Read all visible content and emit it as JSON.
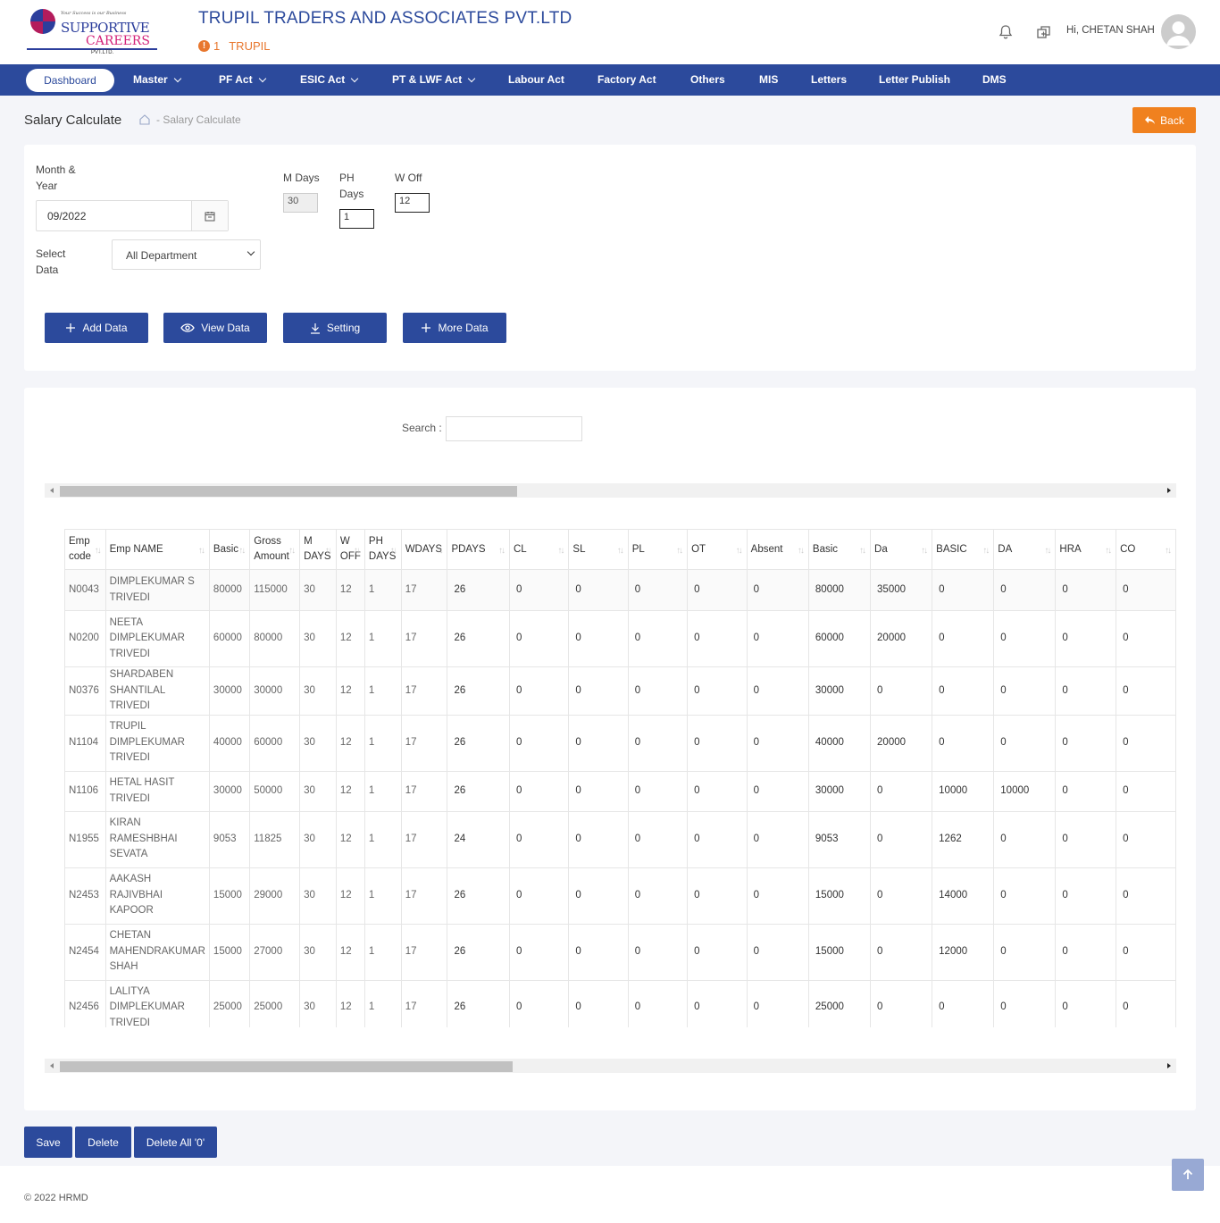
{
  "brand": {
    "tagline": "Your Success is our Business",
    "line1": "SUPPORTIVE",
    "line2": "CAREERS",
    "line3": "PVT.LTD."
  },
  "header": {
    "company_title": "TRUPIL TRADERS AND ASSOCIATES PVT.LTD",
    "sub_count": "1",
    "sub_name": "TRUPIL",
    "greeting": "Hi,  CHETAN SHAH"
  },
  "nav": {
    "items": [
      {
        "label": "Dashboard"
      },
      {
        "label": "Master"
      },
      {
        "label": "PF Act"
      },
      {
        "label": "ESIC Act"
      },
      {
        "label": "PT & LWF Act"
      },
      {
        "label": "Labour Act"
      },
      {
        "label": "Factory Act"
      },
      {
        "label": "Others"
      },
      {
        "label": "MIS"
      },
      {
        "label": "Letters"
      },
      {
        "label": "Letter Publish"
      },
      {
        "label": "DMS"
      }
    ]
  },
  "page": {
    "title": "Salary Calculate",
    "breadcrumb": "- Salary Calculate",
    "back_label": "Back"
  },
  "form": {
    "month_year_label_1": "Month &",
    "month_year_label_2": "Year",
    "month_year_value": "09/2022",
    "select_data_label_1": "Select",
    "select_data_label_2": "Data",
    "department_value": "All Department",
    "mdays_label": "M Days",
    "mdays_value": "30",
    "phdays_label_1": "PH",
    "phdays_label_2": "Days",
    "phdays_value": "1",
    "woff_label": "W Off",
    "woff_value": "12",
    "buttons": {
      "add": "Add Data",
      "view": "View Data",
      "setting": "Setting",
      "more": "More Data"
    }
  },
  "table": {
    "search_label": "Search :",
    "headers": [
      [
        "Emp",
        "code"
      ],
      [
        "Emp NAME"
      ],
      [
        "Basic"
      ],
      [
        "Gross",
        "Amount"
      ],
      [
        "M",
        "DAYS"
      ],
      [
        "W",
        "OFF"
      ],
      [
        "PH",
        "DAYS"
      ],
      [
        "WDAYS"
      ],
      [
        "PDAYS"
      ],
      [
        "CL"
      ],
      [
        "SL"
      ],
      [
        "PL"
      ],
      [
        "OT"
      ],
      [
        "Absent"
      ],
      [
        "Basic"
      ],
      [
        "Da"
      ],
      [
        "BASIC"
      ],
      [
        "DA"
      ],
      [
        "HRA"
      ],
      [
        "CO"
      ]
    ],
    "rows": [
      {
        "code": "N0043",
        "name": [
          "DIMPLEKUMAR S",
          "TRIVEDI"
        ],
        "vals": [
          "80000",
          "115000",
          "30",
          "12",
          "1",
          "17",
          "26",
          "0",
          "0",
          "0",
          "0",
          "0",
          "80000",
          "35000",
          "0",
          "0",
          "0",
          "0"
        ]
      },
      {
        "code": "N0200",
        "name": [
          "NEETA",
          "DIMPLEKUMAR",
          "TRIVEDI"
        ],
        "vals": [
          "60000",
          "80000",
          "30",
          "12",
          "1",
          "17",
          "26",
          "0",
          "0",
          "0",
          "0",
          "0",
          "60000",
          "20000",
          "0",
          "0",
          "0",
          "0"
        ]
      },
      {
        "code": "N0376",
        "name": [
          "SHARDABEN",
          "SHANTILAL TRIVEDI"
        ],
        "vals": [
          "30000",
          "30000",
          "30",
          "12",
          "1",
          "17",
          "26",
          "0",
          "0",
          "0",
          "0",
          "0",
          "30000",
          "0",
          "0",
          "0",
          "0",
          "0"
        ]
      },
      {
        "code": "N1104",
        "name": [
          "TRUPIL",
          "DIMPLEKUMAR",
          "TRIVEDI"
        ],
        "vals": [
          "40000",
          "60000",
          "30",
          "12",
          "1",
          "17",
          "26",
          "0",
          "0",
          "0",
          "0",
          "0",
          "40000",
          "20000",
          "0",
          "0",
          "0",
          "0"
        ]
      },
      {
        "code": "N1106",
        "name": [
          "HETAL HASIT",
          "TRIVEDI"
        ],
        "vals": [
          "30000",
          "50000",
          "30",
          "12",
          "1",
          "17",
          "26",
          "0",
          "0",
          "0",
          "0",
          "0",
          "30000",
          "0",
          "10000",
          "10000",
          "0",
          "0"
        ]
      },
      {
        "code": "N1955",
        "name": [
          "KIRAN",
          "RAMESHBHAI",
          "SEVATA"
        ],
        "vals": [
          "9053",
          "11825",
          "30",
          "12",
          "1",
          "17",
          "24",
          "0",
          "0",
          "0",
          "0",
          "0",
          "9053",
          "0",
          "1262",
          "0",
          "0",
          "0"
        ]
      },
      {
        "code": "N2453",
        "name": [
          "AAKASH",
          "RAJIVBHAI",
          "KAPOOR"
        ],
        "vals": [
          "15000",
          "29000",
          "30",
          "12",
          "1",
          "17",
          "26",
          "0",
          "0",
          "0",
          "0",
          "0",
          "15000",
          "0",
          "14000",
          "0",
          "0",
          "0"
        ]
      },
      {
        "code": "N2454",
        "name": [
          "CHETAN",
          "MAHENDRAKUMAR",
          "SHAH"
        ],
        "vals": [
          "15000",
          "27000",
          "30",
          "12",
          "1",
          "17",
          "26",
          "0",
          "0",
          "0",
          "0",
          "0",
          "15000",
          "0",
          "12000",
          "0",
          "0",
          "0"
        ]
      },
      {
        "code": "N2456",
        "name": [
          "LALITYA",
          "DIMPLEKUMAR",
          "TRIVEDI"
        ],
        "vals": [
          "25000",
          "25000",
          "30",
          "12",
          "1",
          "17",
          "26",
          "0",
          "0",
          "0",
          "0",
          "0",
          "25000",
          "0",
          "0",
          "0",
          "0",
          "0"
        ]
      }
    ],
    "scroll_position": 0.25
  },
  "footer_buttons": {
    "save": "Save",
    "delete": "Delete",
    "delete_all": "Delete All '0'"
  },
  "copyright": "© 2022 HRMD",
  "colors": {
    "primary": "#2c4a9c",
    "accent_orange": "#f0811f",
    "brand_pink": "#d4237a"
  }
}
